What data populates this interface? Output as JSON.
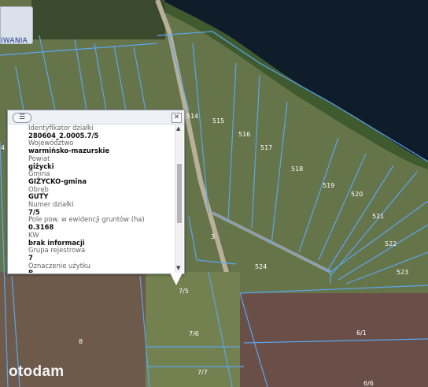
{
  "toolbar": {
    "search_label": "IWANIA"
  },
  "popup": {
    "fields": [
      {
        "label": "Identyfikator działki",
        "value": "280604_2.0005.7/5"
      },
      {
        "label": "Województwo",
        "value": "warmińsko-mazurskie"
      },
      {
        "label": "Powiat",
        "value": "giżycki"
      },
      {
        "label": "Gmina",
        "value": "GIŻYCKO-gmina"
      },
      {
        "label": "Obręb",
        "value": "GUTY"
      },
      {
        "label": "Numer działki",
        "value": "7/5"
      },
      {
        "label": "Pole pow. w ewidencji gruntów (ha)",
        "value": "0.3168"
      },
      {
        "label": "KW",
        "value": "brak informacji"
      },
      {
        "label": "Grupa rejestrowa",
        "value": "7"
      },
      {
        "label": "Oznaczenie użytku",
        "value": "R"
      }
    ]
  },
  "map": {
    "parcel_labels": [
      "514",
      "515",
      "516",
      "517",
      "518",
      "519",
      "520",
      "521",
      "522",
      "523",
      "524",
      "3",
      "7/5",
      "7/6",
      "7/7",
      "8",
      "6/1",
      "6/6",
      "4"
    ]
  },
  "watermark": "otodam",
  "colors": {
    "parcel_line": "#5aa6f0",
    "water": "#0f1d2a",
    "field": "#6b7a4c"
  }
}
